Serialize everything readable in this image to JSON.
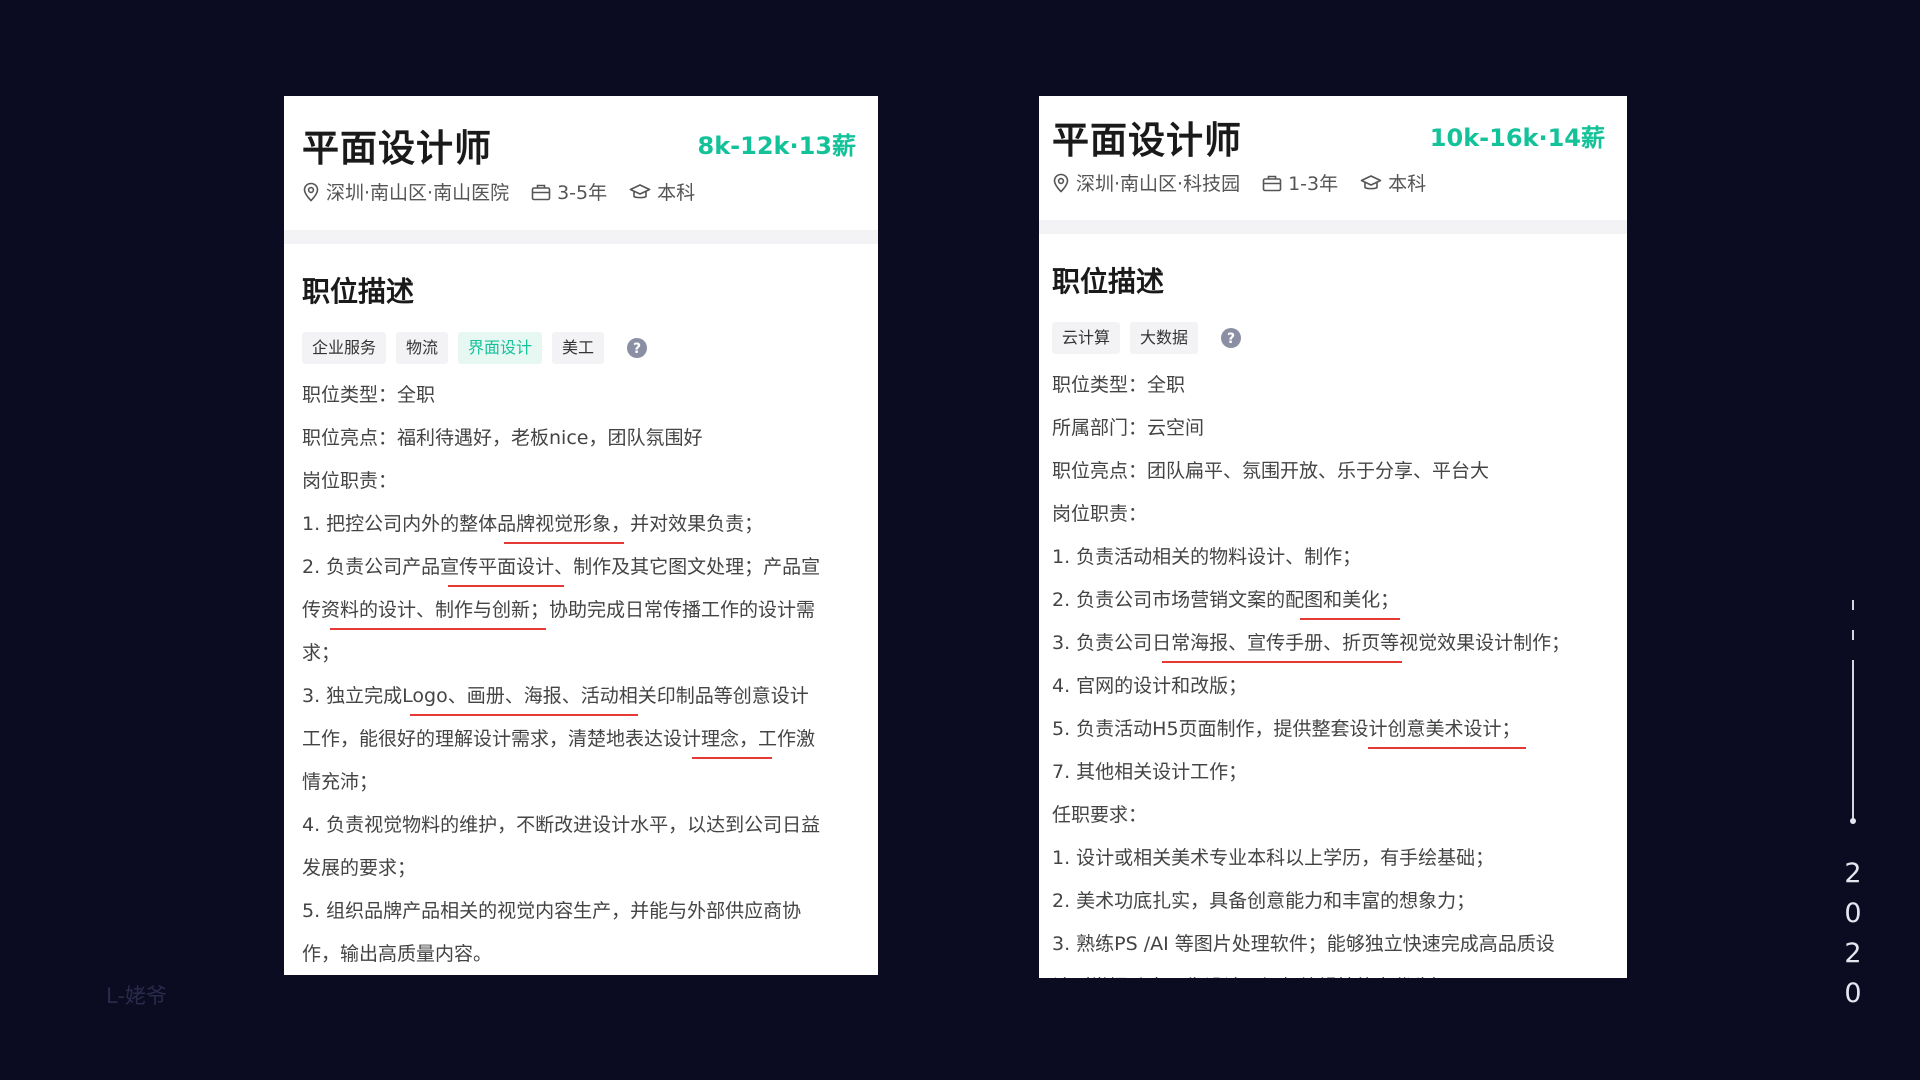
{
  "jobs": [
    {
      "title": "平面设计师",
      "salary": "8k-12k·13薪",
      "location": "深圳·南山区·南山医院",
      "experience": "3-5年",
      "education": "本科",
      "section_title": "职位描述",
      "tags": [
        "企业服务",
        "物流",
        "界面设计",
        "美工"
      ],
      "active_tag": "界面设计",
      "lines": [
        "职位类型：全职",
        "职位亮点：福利待遇好，老板nice，团队氛围好",
        "岗位职责：",
        "1. 把控公司内外的整体品牌视觉形象，并对效果负责；",
        "2. 负责公司产品宣传平面设计、制作及其它图文处理；产品宣",
        "传资料的设计、制作与创新；协助完成日常传播工作的设计需",
        "求；",
        "3. 独立完成Logo、画册、海报、活动相关印制品等创意设计",
        "工作，能很好的理解设计需求，清楚地表达设计理念，工作激",
        "情充沛；",
        "4. 负责视觉物料的维护，不断改进设计水平，以达到公司日益",
        "发展的要求；",
        "5. 组织品牌产品相关的视觉内容生产，并能与外部供应商协",
        "作，输出高质量内容。"
      ]
    },
    {
      "title": "平面设计师",
      "salary": "10k-16k·14薪",
      "location": "深圳·南山区·科技园",
      "experience": "1-3年",
      "education": "本科",
      "section_title": "职位描述",
      "tags": [
        "云计算",
        "大数据"
      ],
      "lines": [
        "职位类型：全职",
        "所属部门：云空间",
        "职位亮点：团队扁平、氛围开放、乐于分享、平台大",
        "岗位职责：",
        "1. 负责活动相关的物料设计、制作；",
        "2. 负责公司市场营销文案的配图和美化；",
        "3. 负责公司日常海报、宣传手册、折页等视觉效果设计制作；",
        "4. 官网的设计和改版；",
        "5. 负责活动H5页面制作，提供整套设计创意美术设计；",
        "7. 其他相关设计工作；",
        "任职要求：",
        "1. 设计或相关美术专业本科以上学历，有手绘基础；",
        "2. 美术功底扎实，具备创意能力和丰富的想象力；",
        "3. 熟练PS /AI 等图片处理软件；能够独立快速完成高品质设",
        "计（掌握动态图像设计、视频编辑技能者优先）"
      ]
    }
  ],
  "watermark": "L-姥爷",
  "year_digits": [
    "2",
    "0",
    "2",
    "0"
  ],
  "colors": {
    "salary": "#14c29a",
    "underline": "#e53935",
    "background": "#0b0b22"
  },
  "icons": {
    "location": "location-pin-icon",
    "experience": "briefcase-icon",
    "education": "graduation-cap-icon",
    "help": "question-icon"
  }
}
